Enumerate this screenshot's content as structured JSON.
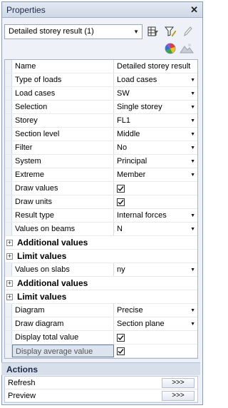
{
  "panel": {
    "title": "Properties",
    "close_glyph": "✕"
  },
  "toolbar": {
    "combo_value": "Detailed storey result (1)",
    "icons": [
      "table-filter-icon",
      "filter-edit-icon",
      "pencil-icon",
      "color-palette-icon",
      "landscape-render-icon"
    ]
  },
  "grid": {
    "rows": [
      {
        "kind": "prop",
        "name": "Name",
        "value": "Detailed storey result",
        "dropdown": false
      },
      {
        "kind": "prop",
        "name": "Type of loads",
        "value": "Load cases",
        "dropdown": true
      },
      {
        "kind": "prop",
        "name": "Load cases",
        "value": "SW",
        "dropdown": true
      },
      {
        "kind": "prop",
        "name": "Selection",
        "value": "Single storey",
        "dropdown": true
      },
      {
        "kind": "prop",
        "name": "Storey",
        "value": "FL1",
        "dropdown": true
      },
      {
        "kind": "prop",
        "name": "Section level",
        "value": "Middle",
        "dropdown": true
      },
      {
        "kind": "prop",
        "name": "Filter",
        "value": "No",
        "dropdown": true
      },
      {
        "kind": "prop",
        "name": "System",
        "value": "Principal",
        "dropdown": true
      },
      {
        "kind": "prop",
        "name": "Extreme",
        "value": "Member",
        "dropdown": true
      },
      {
        "kind": "check",
        "name": "Draw values",
        "checked": true
      },
      {
        "kind": "check",
        "name": "Draw units",
        "checked": true
      },
      {
        "kind": "prop",
        "name": "Result type",
        "value": "Internal forces",
        "dropdown": true
      },
      {
        "kind": "prop",
        "name": "Values on beams",
        "value": "N",
        "dropdown": true
      },
      {
        "kind": "cat",
        "name": "Additional values"
      },
      {
        "kind": "cat",
        "name": "Limit values"
      },
      {
        "kind": "prop",
        "name": "Values on slabs",
        "value": "ny",
        "dropdown": true
      },
      {
        "kind": "cat",
        "name": "Additional values"
      },
      {
        "kind": "cat",
        "name": "Limit values"
      },
      {
        "kind": "prop",
        "name": "Diagram",
        "value": "Precise",
        "dropdown": true
      },
      {
        "kind": "prop",
        "name": "Draw diagram",
        "value": "Section plane",
        "dropdown": true
      },
      {
        "kind": "check",
        "name": "Display total value",
        "checked": true
      },
      {
        "kind": "check",
        "name": "Display average value",
        "checked": true,
        "selected": true
      }
    ]
  },
  "actions": {
    "header": "Actions",
    "items": [
      {
        "label": "Refresh",
        "button": ">>>"
      },
      {
        "label": "Preview",
        "button": ">>>"
      }
    ]
  }
}
